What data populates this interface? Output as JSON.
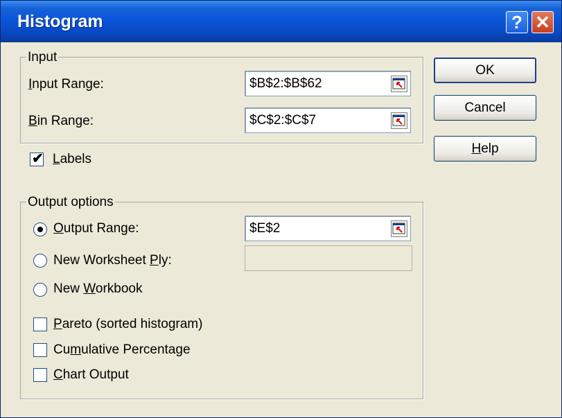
{
  "window": {
    "title": "Histogram",
    "help_button": "?",
    "close_button": "✕"
  },
  "input": {
    "legend": "Input",
    "input_range": {
      "label_accel": "I",
      "label_rest": "nput Range:",
      "value": "$B$2:$B$62"
    },
    "bin_range": {
      "label_accel": "B",
      "label_rest": "in Range:",
      "value": "$C$2:$C$7"
    }
  },
  "labels_checkbox": {
    "checked": true,
    "mark": "✔",
    "label_accel": "L",
    "label_rest": "abels"
  },
  "output": {
    "legend": "Output options",
    "output_range": {
      "selected": true,
      "label_accel": "O",
      "label_rest": "utput Range:",
      "value": "$E$2"
    },
    "new_worksheet_ply": {
      "selected": false,
      "label_pre": "New Worksheet ",
      "label_accel": "P",
      "label_post": "ly:",
      "value": ""
    },
    "new_workbook": {
      "selected": false,
      "label_pre": "New ",
      "label_accel": "W",
      "label_post": "orkbook"
    },
    "pareto": {
      "checked": false,
      "label_accel": "P",
      "label_rest": "areto (sorted histogram)"
    },
    "cumulative": {
      "checked": false,
      "label_pre": "Cu",
      "label_accel": "m",
      "label_post": "ulative Percentage"
    },
    "chart_output": {
      "checked": false,
      "label_accel": "C",
      "label_rest": "hart Output"
    }
  },
  "buttons": {
    "ok": "OK",
    "cancel": "Cancel",
    "help_accel": "H",
    "help_rest": "elp"
  }
}
